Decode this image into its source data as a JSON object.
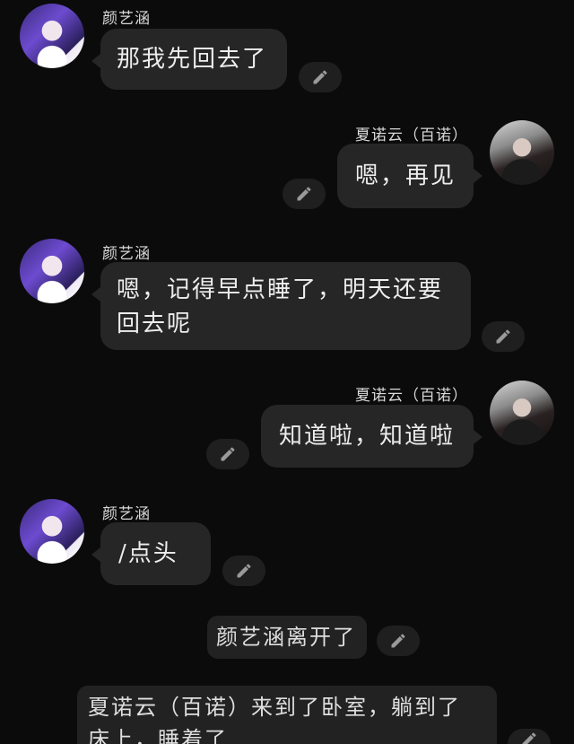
{
  "messages": [
    {
      "sender": "颜艺涵",
      "text": "那我先回去了"
    },
    {
      "sender": "夏诺云（百诺）",
      "text": "嗯，再见"
    },
    {
      "sender": "颜艺涵",
      "text_line1": "嗯，记得早点睡了，明天还要",
      "text_line2": "回去呢"
    },
    {
      "sender": "夏诺云（百诺）",
      "text": "知道啦，知道啦"
    },
    {
      "sender": "颜艺涵",
      "text": "/点头"
    }
  ],
  "system": [
    {
      "text": "颜艺涵离开了"
    },
    {
      "text_line1": "夏诺云（百诺）来到了卧室，躺到了",
      "text_line2": "床上，睡着了"
    }
  ],
  "icons": {
    "edit": "pencil-icon",
    "avatar_left": "purple-hair-avatar",
    "avatar_right": "dark-hair-avatar"
  },
  "colors": {
    "background": "#0b0b0b",
    "bubble": "#262626"
  }
}
